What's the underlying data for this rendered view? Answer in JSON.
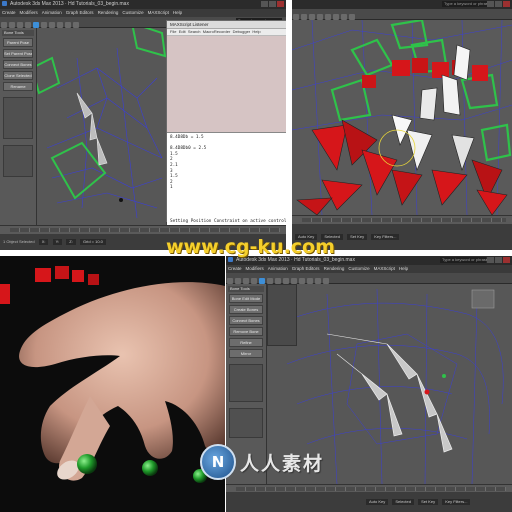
{
  "top_left": {
    "title": "Autodesk 3ds Max 2013 · Hd Tutorials_03_begin.max",
    "menu": [
      "Create",
      "Modifiers",
      "Animation",
      "Graph Editors",
      "Rendering",
      "Customize",
      "MAXScript",
      "Help"
    ],
    "search_placeholder": "Type a keyword or phrase",
    "side_buttons": [
      "Parent Pose",
      "Set Parent Pose",
      "Connect Bones",
      "Clone Selected",
      "Rename"
    ],
    "side_header": "Bone Tools",
    "listener": {
      "title": "MAXScript Listener",
      "menu": [
        "File",
        "Edit",
        "Search",
        "MacroRecorder",
        "Debugger",
        "Help"
      ],
      "output": "8.4D8Db = 1.5\n\n8.4D8Db0 = 2.5\n1.5\n2\n2.1\n3\n1.5\n2\n1\n\n\n\n\n\nSetting Position Constraint on active controller"
    },
    "status_left": "1 Object Selected",
    "status_fields": [
      "X:",
      "Y:",
      "Z:",
      "Grid = 10.0"
    ]
  },
  "top_right": {
    "search_placeholder": "Type a keyword or phrase",
    "status_fields": [
      "Auto Key",
      "Selected",
      "Set Key",
      "Key Filters..."
    ]
  },
  "bottom_right": {
    "title": "Autodesk 3ds Max 2013 · Hd Tutorials_03_begin.max",
    "menu": [
      "Create",
      "Modifiers",
      "Animation",
      "Graph Editors",
      "Rendering",
      "Customize",
      "MAXScript",
      "Help"
    ],
    "search_placeholder": "Type a keyword or phrase",
    "side_header": "Bone Tools",
    "side_buttons": [
      "Bone Edit Mode",
      "Create Bones",
      "Connect Bones",
      "Remove Bone",
      "Refine",
      "Mirror"
    ],
    "status_fields": [
      "Auto Key",
      "Selected",
      "Set Key",
      "Key Filters..."
    ]
  },
  "watermarks": {
    "site": "www.cg-ku.com",
    "brand": "人人素材",
    "logo_letter": "N"
  },
  "colors": {
    "bone_green": "#2fc24a",
    "wire_blue": "#3b3fd6",
    "red_mesh": "#d6161a",
    "watermark_yellow": "#f5cf2c",
    "accent_blue": "#3d8fd8"
  }
}
